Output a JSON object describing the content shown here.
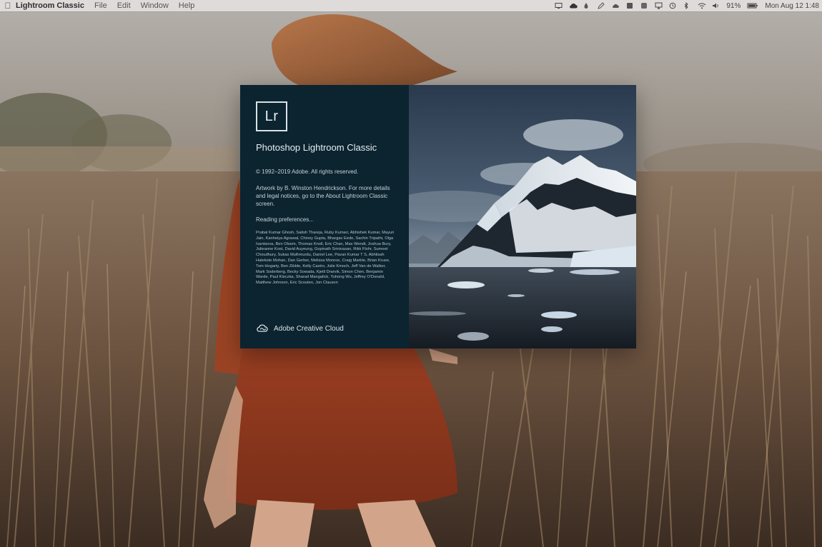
{
  "menubar": {
    "apple_icon": "apple-logo-icon",
    "app_name": "Lightroom Classic",
    "menus": [
      "File",
      "Edit",
      "Window",
      "Help"
    ],
    "status_icons": [
      "display-icon",
      "creative-cloud-icon",
      "drop-icon",
      "pen-icon",
      "cloud-icon",
      "app-icon",
      "app-icon",
      "airplay-icon",
      "time-machine-icon",
      "bluetooth-icon",
      "wifi-icon",
      "volume-icon"
    ],
    "battery_percent": "91%",
    "battery_icon": "battery-icon",
    "clock": "Mon Aug 12  1:48"
  },
  "splash": {
    "logo_text": "Lr",
    "product_name": "Photoshop Lightroom Classic",
    "copyright": "© 1992–2019 Adobe. All rights reserved.",
    "artwork_credit": "Artwork by B. Winston Hendrickson. For more details and legal notices, go to the About Lightroom Classic screen.",
    "status": "Reading preferences...",
    "credits": "Prabal Kumar Ghosh, Satish Thareja, Ruby Kumari, Abhishek Kumar, Mayuri Jain, Kanheiya Agrawal, Chinoy Gupta, Bhargav Eede, Sachin Tripathi, Olga Ivantsova, Ben Olsem, Thomas Knoll, Eric Chan, Max Wendt, Joshua Bury, Julieanne Kost, David Auyeung, Gopinath Srinivasan, Rikk Flohr, Sumeet Choudhury, Sukas Muthmurdu, Daniel Lee, Pavan Kumar T S, Abhilash Halekote Mohan, Dan Gerber, Melissa Monroe, Craig Marble, Brian Kruse, Tom Hogarty, Ben Zibble, Kelly Castro, Julie Kmoch, Jeff Van de Walker, Mark Soderberg, Becky Sowada, Kjetil Drarvik, Simon Chen, Benjamin Warde, Paul Kleczka, Sharad Mangalick, Yuhong Wu, Jeffrey O'Donald, Matthew Johnson, Eric Scouten, Jon Clauson",
    "brand": "Adobe Creative Cloud",
    "brand_icon": "creative-cloud-icon",
    "artwork_image": "iceberg-mountain-artwork"
  },
  "colors": {
    "splash_panel": "#0b2430",
    "menubar": "#e2dedd"
  }
}
